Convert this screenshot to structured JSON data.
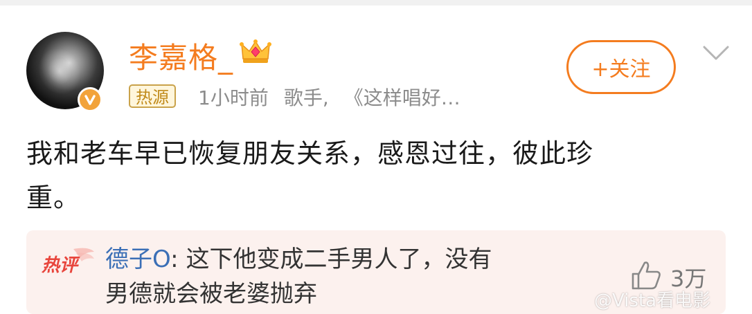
{
  "post": {
    "username": "李嘉格_",
    "badge_icon": "crown-icon",
    "hot_tag": "热源",
    "time": "1小时前",
    "category": "歌手,",
    "topic": "《这样唱好…",
    "follow_label": "+关注",
    "text_line1": "我和老车早已恢复朋友关系，感恩过往，彼此珍",
    "text_line2": "重。"
  },
  "hot_comment": {
    "badge": "热评",
    "author": "德子O",
    "separator": ":",
    "text_line1": " 这下他变成二手男人了，没有",
    "text_line2": "男德就会被老婆抛弃",
    "like_count": "3万"
  },
  "watermark": "@Vista看电影",
  "colors": {
    "accent": "#f47c1f",
    "link_blue": "#3b6fb6",
    "hot_red": "#e8453c",
    "comment_bg": "#fcf1ee"
  }
}
